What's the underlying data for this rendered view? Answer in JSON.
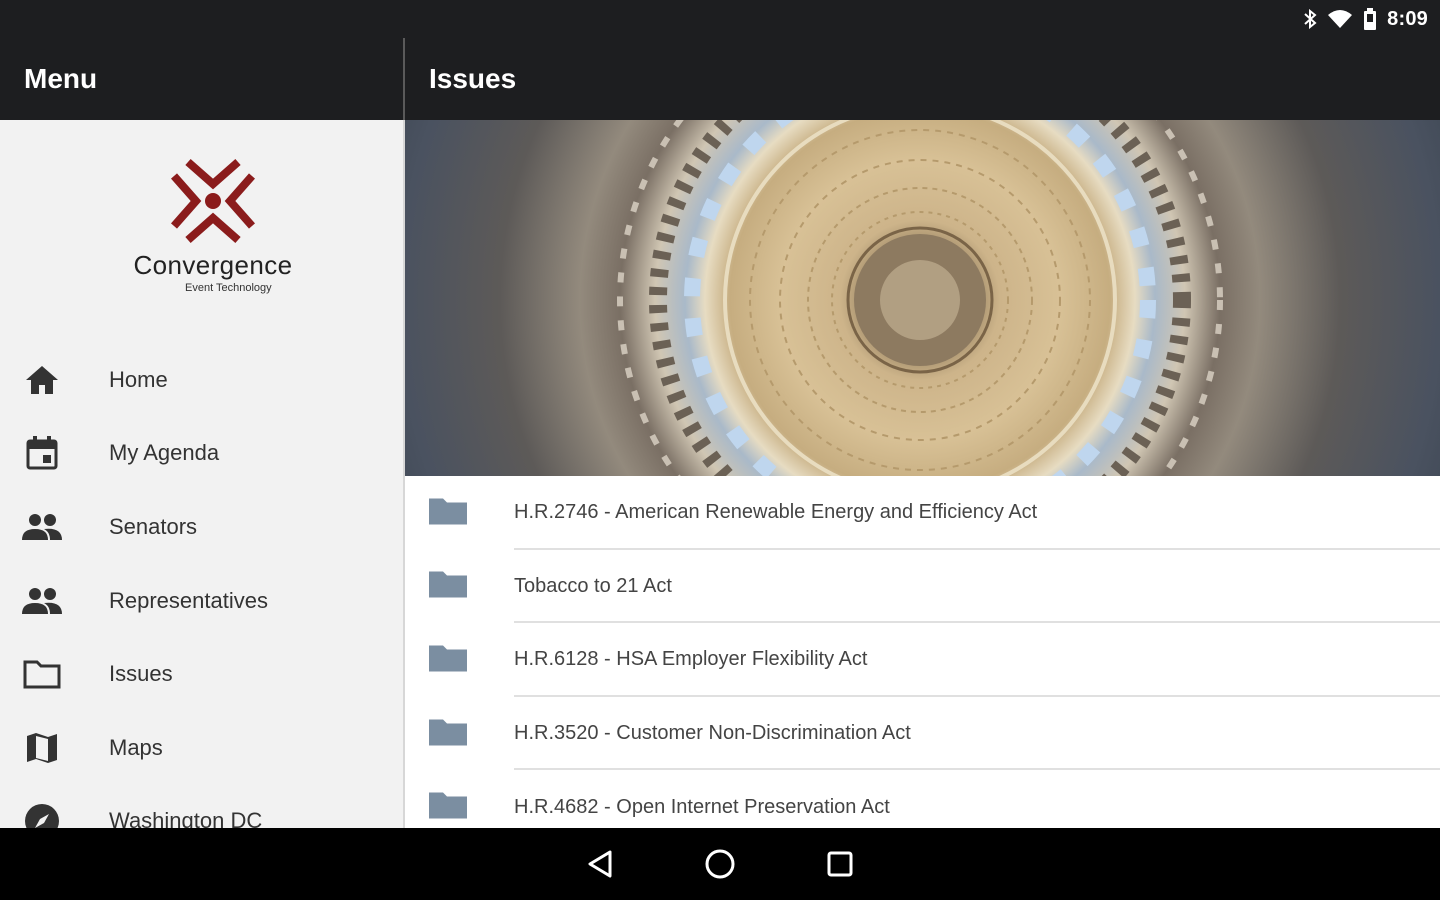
{
  "status_bar": {
    "time": "8:09",
    "icons": [
      "bluetooth-icon",
      "wifi-icon",
      "battery-icon"
    ]
  },
  "drawer": {
    "title": "Menu",
    "logo": {
      "brand": "Convergence",
      "subtitle": "Event Technology",
      "accent": "#8b1c1c"
    },
    "items": [
      {
        "label": "Home",
        "icon": "home-icon"
      },
      {
        "label": "My Agenda",
        "icon": "calendar-icon"
      },
      {
        "label": "Senators",
        "icon": "people-icon"
      },
      {
        "label": "Representatives",
        "icon": "people-icon"
      },
      {
        "label": "Issues",
        "icon": "folder-outline-icon"
      },
      {
        "label": "Maps",
        "icon": "map-icon"
      },
      {
        "label": "Washington DC",
        "icon": "compass-icon"
      }
    ]
  },
  "main": {
    "title": "Issues",
    "issues": [
      "H.R.2746 - American Renewable Energy and Efficiency Act",
      "Tobacco to 21 Act",
      "H.R.6128 - HSA Employer Flexibility Act",
      "H.R.3520 - Customer Non-Discrimination Act",
      "H.R.4682 - Open Internet Preservation Act"
    ]
  },
  "colors": {
    "bar": "#1d1e20",
    "drawer_bg": "#f2f2f2",
    "folder": "#7b8ea1",
    "logo_red": "#8b1c1c"
  }
}
